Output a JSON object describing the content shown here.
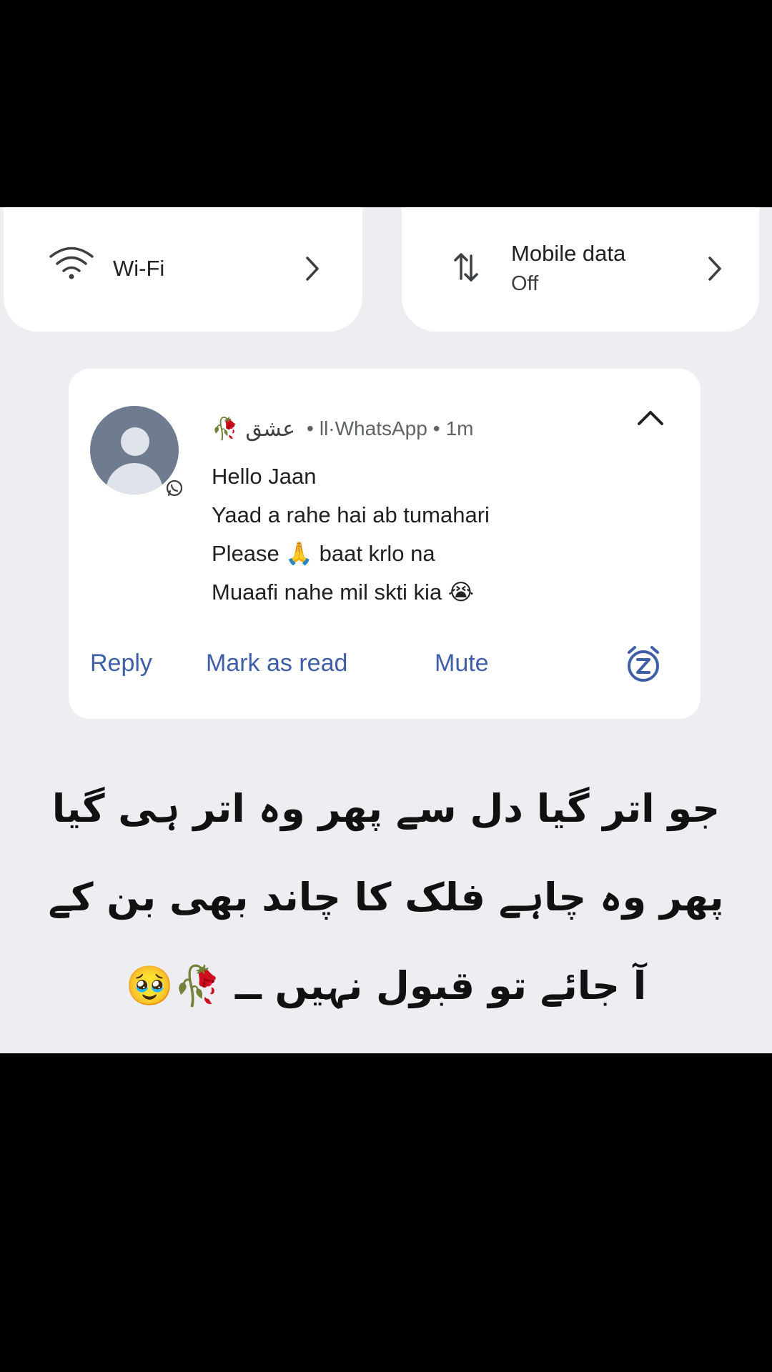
{
  "quick_settings": {
    "wifi": {
      "label": "Wi-Fi",
      "icon": "wifi-icon"
    },
    "mobile_data": {
      "label": "Mobile data",
      "status": "Off",
      "icon": "mobile-data-icon"
    }
  },
  "notification": {
    "sender_emoji": "🥀",
    "sender": "عشق",
    "sep1": "•",
    "app": "ll·WhatsApp",
    "sep2": "•",
    "time": "1m",
    "lines": [
      "Hello Jaan",
      "Yaad a rahe hai ab tumahari",
      "Please 🙏 baat krlo na",
      "Muaafi nahe mil skti kia 😭"
    ],
    "actions": {
      "reply": "Reply",
      "mark_as_read": "Mark as read",
      "mute": "Mute"
    },
    "accent_color": "#3e5ea8"
  },
  "poetry": {
    "lines": [
      "جو اتر گیا دل سے پھر وہ اتر ہی گیا",
      "پھر وہ چاہے فلک کا چاند بھی بن کے",
      "آ جائے تو قبول نہیں ــ 🥀🥹"
    ]
  }
}
